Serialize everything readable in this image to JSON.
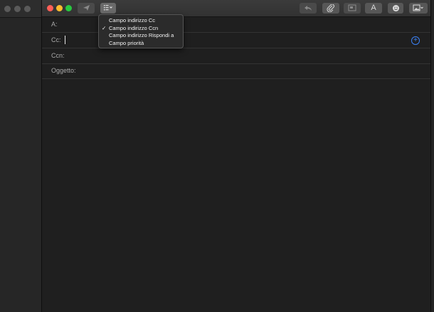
{
  "toolbar": {
    "send_icon": "paper-plane-icon",
    "header_fields_icon": "list-chevron-icon",
    "reply_icon": "reply-arrow-icon",
    "attach_icon": "paperclip-icon",
    "browser_icon": "photo-browser-icon",
    "format_label": "A",
    "emoji_icon": "smiley-icon",
    "photo_icon": "image-chevron-icon"
  },
  "traffic_lights": {
    "close": "#ff5f57",
    "minimize": "#febc2e",
    "zoom": "#28c840",
    "inactive": "#5a5a5a"
  },
  "fields": {
    "to_label": "A:",
    "cc_label": "Cc:",
    "bcc_label": "Ccn:",
    "subject_label": "Oggetto:",
    "add_contact_icon": "plus-circle-icon"
  },
  "menu": {
    "items": [
      {
        "label": "Campo indirizzo Cc",
        "checked": false
      },
      {
        "label": "Campo indirizzo Ccn",
        "checked": true
      },
      {
        "label": "Campo indirizzo Rispondi a",
        "checked": false
      },
      {
        "label": "Campo priorità",
        "checked": false
      }
    ],
    "check_glyph": "✓"
  },
  "colors": {
    "accent": "#3b82f6",
    "window_bg": "#1f1f1f"
  }
}
